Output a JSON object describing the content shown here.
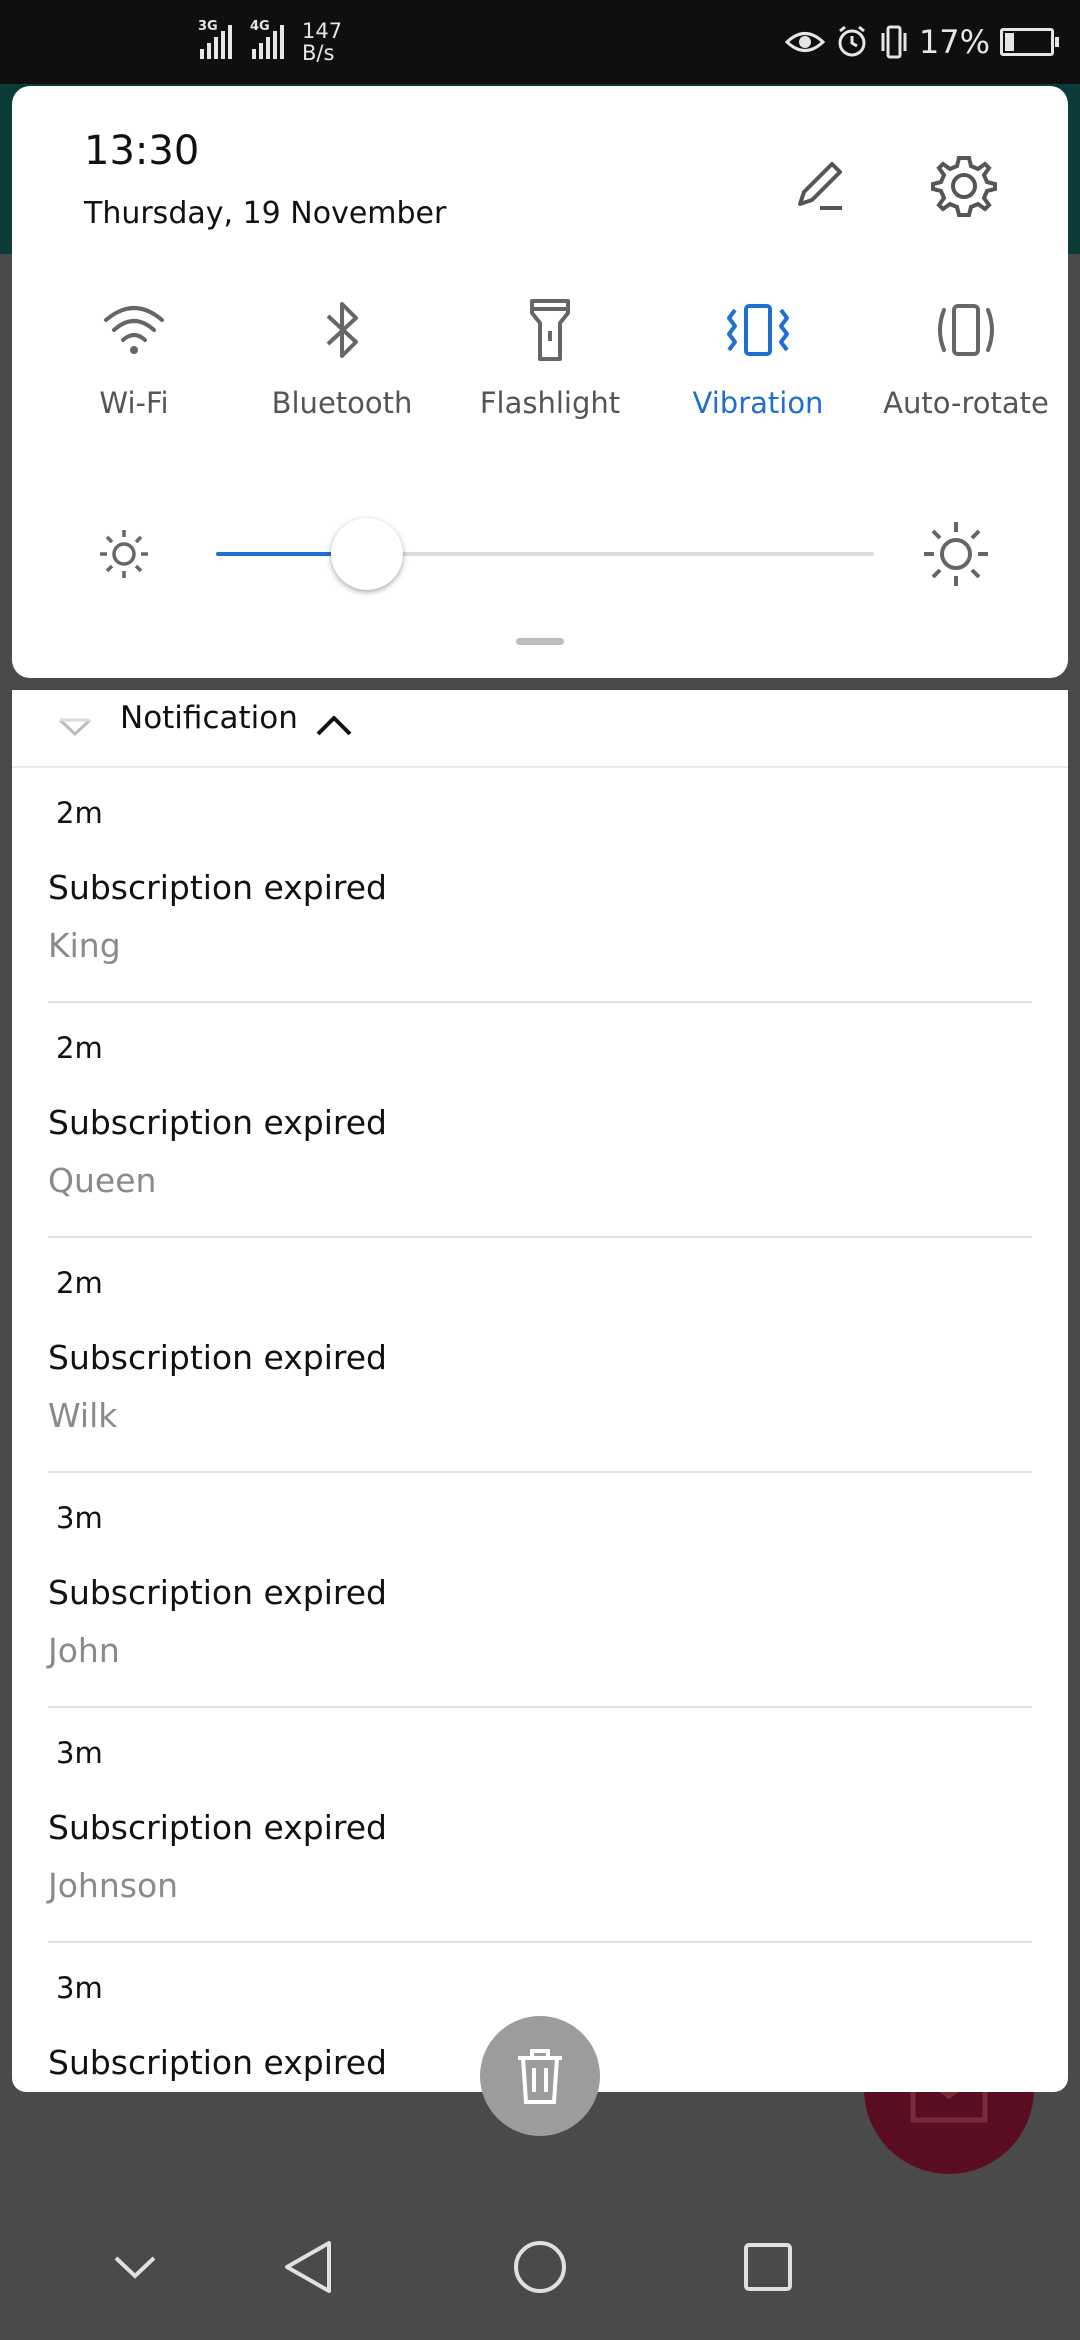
{
  "status_bar": {
    "signal1_label": "3G",
    "signal2_label": "4G",
    "net_speed_value": "147",
    "net_speed_unit": "B/s",
    "battery_percent": "17%",
    "icons": [
      "eye-comfort-icon",
      "alarm-icon",
      "vibrate-icon",
      "battery-icon"
    ]
  },
  "quick_settings": {
    "time": "13:30",
    "date": "Thursday, 19 November",
    "tiles": [
      {
        "label": "Wi-Fi",
        "icon": "wifi-icon",
        "active": false
      },
      {
        "label": "Bluetooth",
        "icon": "bluetooth-icon",
        "active": false
      },
      {
        "label": "Flashlight",
        "icon": "flashlight-icon",
        "active": false
      },
      {
        "label": "Vibration",
        "icon": "vibration-icon",
        "active": true
      },
      {
        "label": "Auto-rotate",
        "icon": "auto-rotate-icon",
        "active": false
      }
    ],
    "brightness_level": 0.23,
    "accent_color": "#1f6fd1"
  },
  "notifications": {
    "app_name": "Notification",
    "items": [
      {
        "time": "2m",
        "title": "Subscription expired",
        "name": "King"
      },
      {
        "time": "2m",
        "title": "Subscription expired",
        "name": "Queen"
      },
      {
        "time": "2m",
        "title": "Subscription expired",
        "name": "Wilk"
      },
      {
        "time": "3m",
        "title": "Subscription expired",
        "name": "John"
      },
      {
        "time": "3m",
        "title": "Subscription expired",
        "name": "Johnson"
      },
      {
        "time": "3m",
        "title": "Subscription expired",
        "name": ""
      }
    ]
  },
  "nav_bar": {
    "icons": [
      "collapse-icon",
      "back-icon",
      "home-icon",
      "recents-icon"
    ]
  }
}
